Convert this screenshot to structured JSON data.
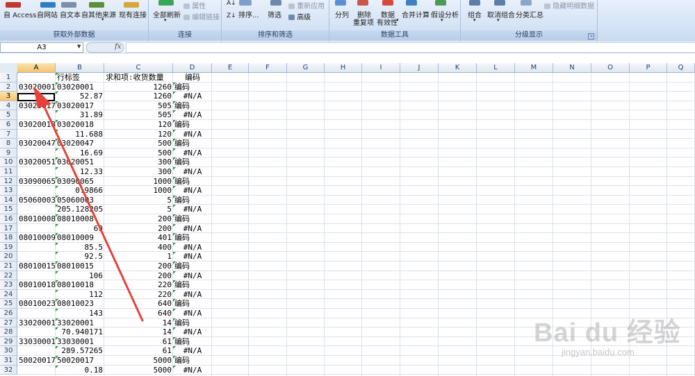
{
  "ribbon": {
    "groups": [
      {
        "label": "获取外部数据",
        "buttons": [
          "自 Access",
          "自网站",
          "自文本",
          "自其他来源",
          "现有连接"
        ]
      },
      {
        "label": "连接",
        "buttons": [
          "全部刷新",
          "属性",
          "编辑链接"
        ]
      },
      {
        "label": "排序和筛选",
        "buttons": [
          "排序...",
          "筛选",
          "重新应用",
          "高级"
        ]
      },
      {
        "label": "数据工具",
        "buttons": [
          "分列",
          "删除",
          "重复项",
          "数据",
          "有效性",
          "合并计算",
          "假设分析"
        ]
      },
      {
        "label": "分级显示",
        "buttons": [
          "组合",
          "取消组合",
          "分类汇总",
          "隐藏明细数据"
        ]
      }
    ]
  },
  "formula_bar": {
    "name_box": "A3",
    "fx": "fx",
    "value": ""
  },
  "columns": [
    "A",
    "B",
    "C",
    "D",
    "E",
    "F",
    "G",
    "H",
    "I",
    "J",
    "K",
    "L",
    "M",
    "N",
    "O",
    "P",
    "Q"
  ],
  "rows": [
    {
      "n": "1",
      "a": "",
      "b": "行标签",
      "c": "求和项:收货数量",
      "d": "编码"
    },
    {
      "n": "2",
      "a": "03020001",
      "b": "03020001",
      "c": "1260",
      "d": "编码"
    },
    {
      "n": "3",
      "a": "",
      "b": "52.87",
      "c": "1260",
      "d": "#N/A"
    },
    {
      "n": "4",
      "a": "03020017",
      "b": "03020017",
      "c": "505",
      "d": "编码"
    },
    {
      "n": "5",
      "a": "",
      "b": "31.89",
      "c": "505",
      "d": "#N/A"
    },
    {
      "n": "6",
      "a": "03020018",
      "b": "03020018",
      "c": "120",
      "d": "编码"
    },
    {
      "n": "7",
      "a": "",
      "b": "11.688",
      "c": "120",
      "d": "#N/A"
    },
    {
      "n": "8",
      "a": "03020047",
      "b": "03020047",
      "c": "500",
      "d": "编码"
    },
    {
      "n": "9",
      "a": "",
      "b": "16.69",
      "c": "500",
      "d": "#N/A"
    },
    {
      "n": "10",
      "a": "03020051",
      "b": "03020051",
      "c": "300",
      "d": "编码"
    },
    {
      "n": "11",
      "a": "",
      "b": "12.33",
      "c": "300",
      "d": "#N/A"
    },
    {
      "n": "12",
      "a": "03090065",
      "b": "03090065",
      "c": "1000",
      "d": "编码"
    },
    {
      "n": "13",
      "a": "",
      "b": "0.9866",
      "c": "1000",
      "d": "#N/A"
    },
    {
      "n": "14",
      "a": "05060003",
      "b": "05060003",
      "c": "5",
      "d": "编码"
    },
    {
      "n": "15",
      "a": "",
      "b": "205.128205",
      "c": "5",
      "d": "#N/A"
    },
    {
      "n": "16",
      "a": "08010008",
      "b": "08010008",
      "c": "200",
      "d": "编码"
    },
    {
      "n": "17",
      "a": "",
      "b": "69",
      "c": "200",
      "d": "#N/A"
    },
    {
      "n": "18",
      "a": "08010009",
      "b": "08010009",
      "c": "401",
      "d": "编码"
    },
    {
      "n": "19",
      "a": "",
      "b": "85.5",
      "c": "400",
      "d": "#N/A"
    },
    {
      "n": "20",
      "a": "",
      "b": "92.5",
      "c": "1",
      "d": "#N/A"
    },
    {
      "n": "21",
      "a": "08010015",
      "b": "08010015",
      "c": "200",
      "d": "编码"
    },
    {
      "n": "22",
      "a": "",
      "b": "106",
      "c": "200",
      "d": "#N/A"
    },
    {
      "n": "23",
      "a": "08010018",
      "b": "08010018",
      "c": "220",
      "d": "编码"
    },
    {
      "n": "24",
      "a": "",
      "b": "112",
      "c": "220",
      "d": "#N/A"
    },
    {
      "n": "25",
      "a": "08010023",
      "b": "08010023",
      "c": "640",
      "d": "编码"
    },
    {
      "n": "26",
      "a": "",
      "b": "143",
      "c": "640",
      "d": "#N/A"
    },
    {
      "n": "27",
      "a": "33020001",
      "b": "33020001",
      "c": "14",
      "d": "编码"
    },
    {
      "n": "28",
      "a": "",
      "b": "70.940171",
      "c": "14",
      "d": "#N/A"
    },
    {
      "n": "29",
      "a": "33030001",
      "b": "33030001",
      "c": "61",
      "d": "编码"
    },
    {
      "n": "30",
      "a": "",
      "b": "289.57265",
      "c": "61",
      "d": "#N/A"
    },
    {
      "n": "31",
      "a": "50020017",
      "b": "50020017",
      "c": "5000",
      "d": "编码"
    },
    {
      "n": "32",
      "a": "",
      "b": "0.18",
      "c": "5000",
      "d": "#N/A"
    }
  ],
  "watermark": {
    "logo": "Bai du 经验",
    "sub": "jingyan.baidu.com"
  },
  "colors": {
    "accent_arrow": "#e8413a",
    "selected_header": "#f6c46d",
    "error_triangle": "#2e9a3c"
  }
}
